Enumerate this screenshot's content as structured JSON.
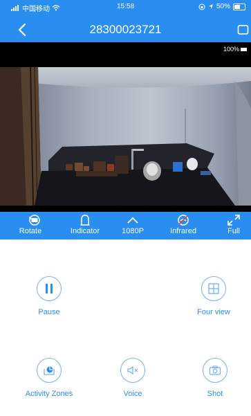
{
  "status": {
    "carrier": "中国移动",
    "time": "15:58",
    "battery": "50%"
  },
  "nav": {
    "title": "28300023721"
  },
  "video": {
    "overlay_percent": "100%"
  },
  "toolbar": {
    "items": [
      {
        "label": "Rotate",
        "icon": "rotate-icon"
      },
      {
        "label": "Indicator",
        "icon": "indicator-icon"
      },
      {
        "label": "1080P",
        "icon": "chevron-up-icon"
      },
      {
        "label": "Infrared",
        "icon": "infrared-off-icon"
      },
      {
        "label": "Full",
        "icon": "expand-icon"
      }
    ]
  },
  "controls": {
    "pause": {
      "label": "Pause",
      "icon": "pause-icon"
    },
    "four_view": {
      "label": "Four view",
      "icon": "grid-icon"
    },
    "activity_zones": {
      "label": "Activity Zones",
      "icon": "activity-zones-icon"
    },
    "voice": {
      "label": "Voice",
      "icon": "speaker-muted-icon"
    },
    "shot": {
      "label": "Shot",
      "icon": "camera-icon"
    }
  },
  "colors": {
    "accent": "#2a8ef0",
    "circle_border": "#6fb2f4",
    "video_bg": "#000000"
  }
}
